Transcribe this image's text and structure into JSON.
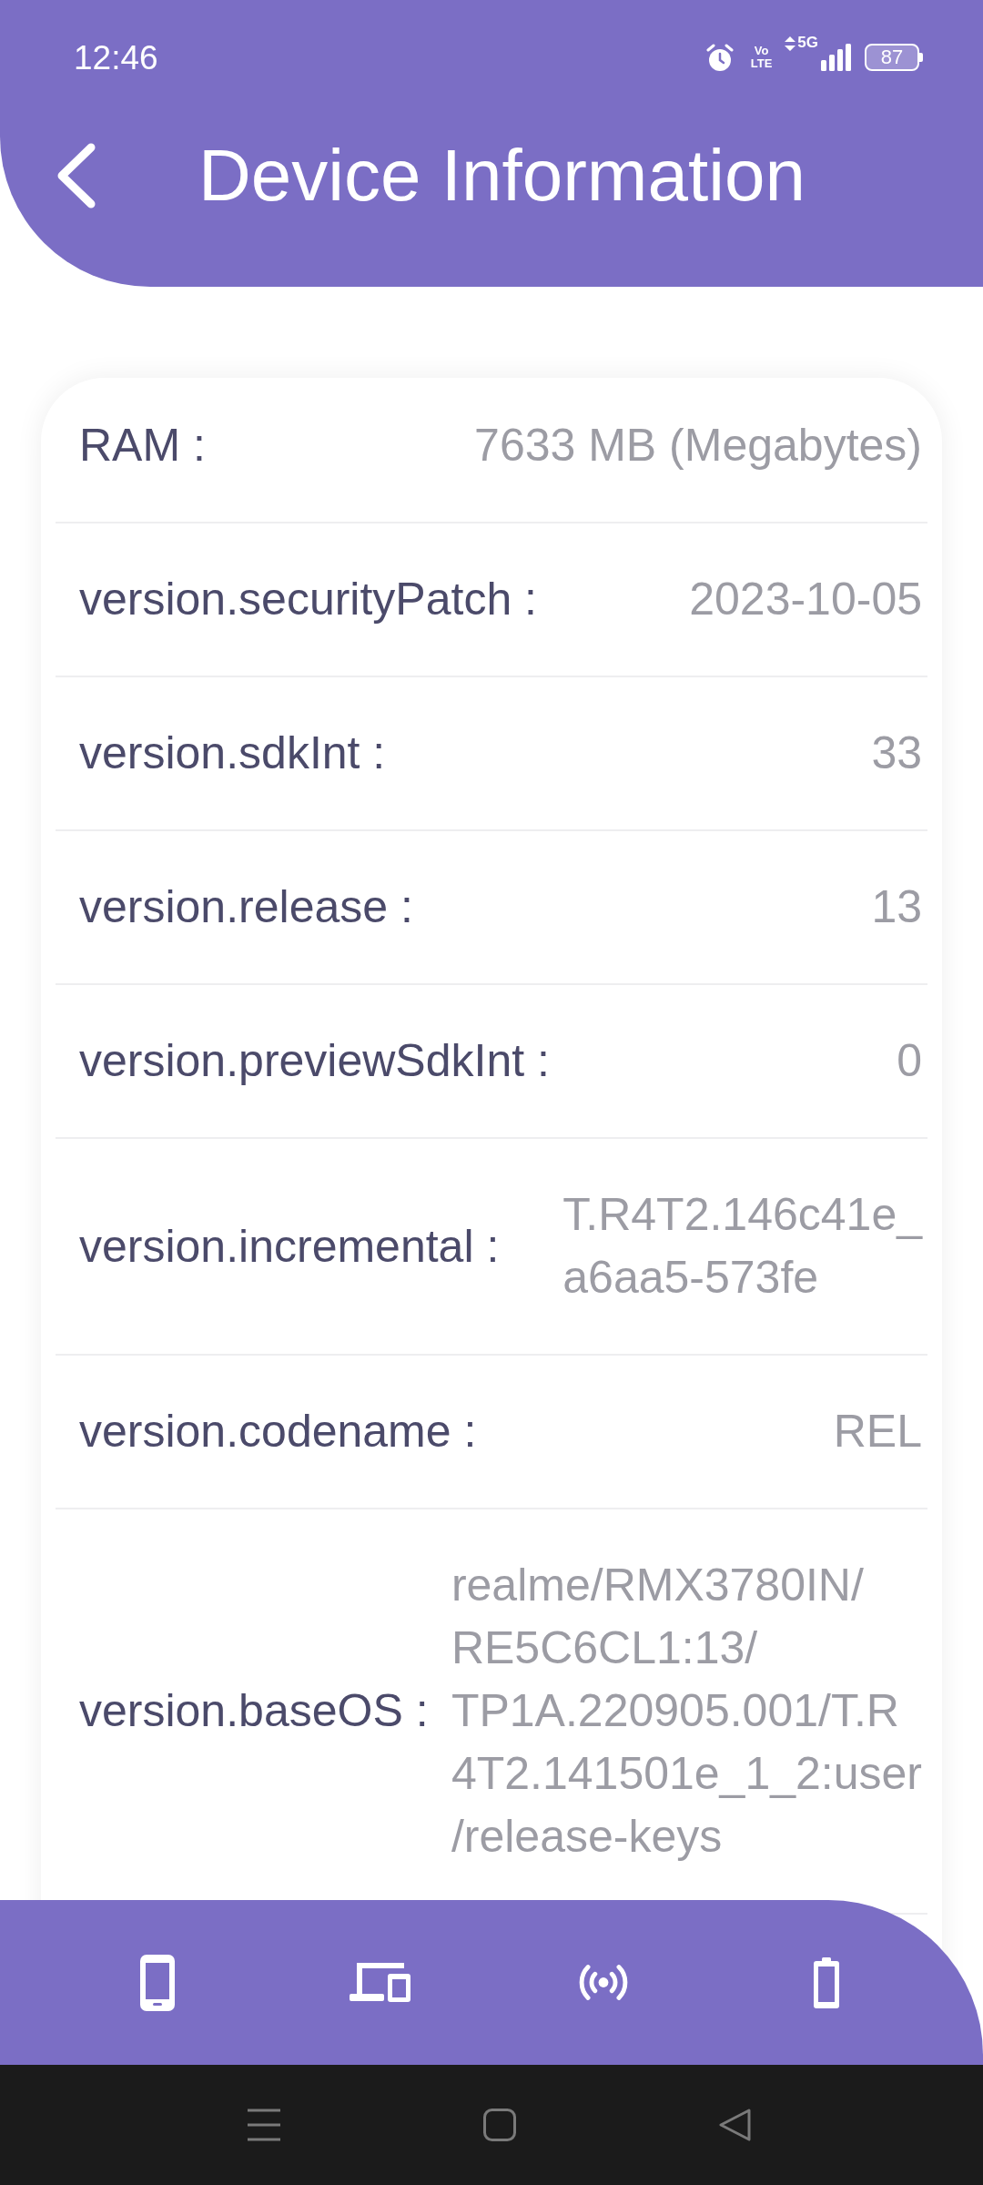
{
  "status_bar": {
    "time": "12:46",
    "volte": [
      "Vo",
      "LTE"
    ],
    "network": "5G",
    "battery": "87"
  },
  "header": {
    "title": "Device Information"
  },
  "info_rows": [
    {
      "label": "RAM :",
      "value_lines": [
        "7633 MB (Megabytes)"
      ]
    },
    {
      "label": "version.securityPatch :",
      "value_lines": [
        "2023-10-05"
      ]
    },
    {
      "label": "version.sdkInt :",
      "value_lines": [
        "33"
      ]
    },
    {
      "label": "version.release :",
      "value_lines": [
        "13"
      ]
    },
    {
      "label": "version.previewSdkInt :",
      "value_lines": [
        "0"
      ]
    },
    {
      "label": "version.incremental :",
      "value_lines": [
        "T.R4T2.146c41e_",
        "a6aa5-573fe"
      ]
    },
    {
      "label": "version.codename :",
      "value_lines": [
        "REL"
      ]
    },
    {
      "label": "version.baseOS :",
      "value_lines": [
        "realme/RMX3780IN/",
        "RE5C6CL1:13/",
        "TP1A.220905.001/T.R",
        "4T2.141501e_1_2:user",
        "/release-keys"
      ]
    }
  ],
  "bottom_nav": [
    {
      "kind": "phone"
    },
    {
      "kind": "devices"
    },
    {
      "kind": "broadcast"
    },
    {
      "kind": "battery"
    }
  ],
  "system_nav": [
    {
      "kind": "menu"
    },
    {
      "kind": "home"
    },
    {
      "kind": "back"
    }
  ]
}
